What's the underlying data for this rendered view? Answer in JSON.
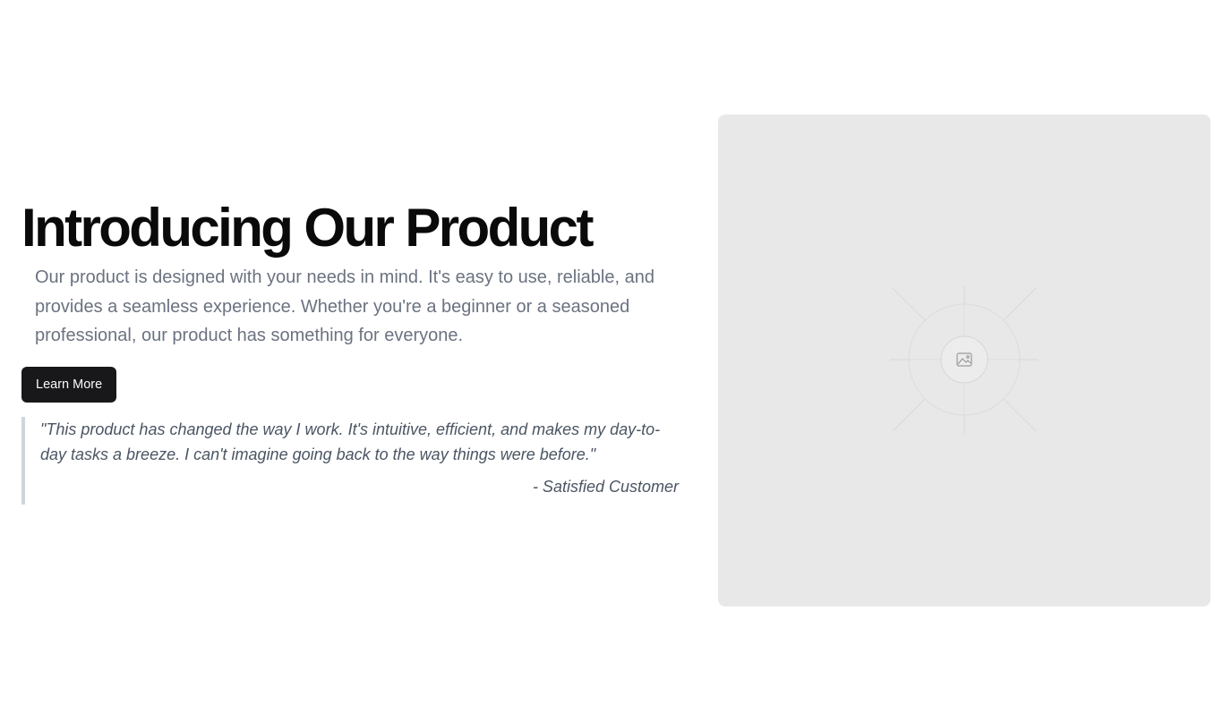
{
  "hero": {
    "title": "Introducing Our Product",
    "description": "Our product is designed with your needs in mind. It's easy to use, reliable, and provides a seamless experience. Whether you're a beginner or a seasoned professional, our product has something for everyone.",
    "cta_label": "Learn More"
  },
  "testimonial": {
    "quote": "\"This product has changed the way I work. It's intuitive, efficient, and makes my day-to-day tasks a breeze. I can't imagine going back to the way things were before.\"",
    "author": "- Satisfied Customer"
  },
  "media": {
    "icon": "image-placeholder-icon"
  },
  "colors": {
    "button_bg": "#18181b",
    "button_text": "#fafafa",
    "heading": "#0a0a0a",
    "body_text": "#6b7280",
    "quote_text": "#4b5563",
    "quote_border": "#d1d5db",
    "placeholder_bg": "#e8e8e8"
  }
}
